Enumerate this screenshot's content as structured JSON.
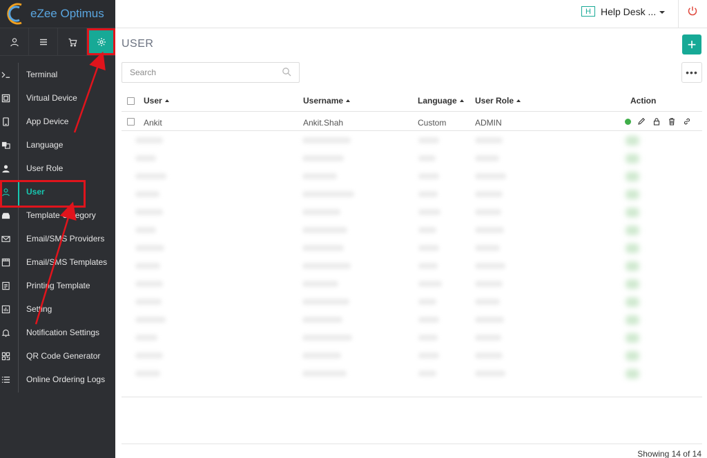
{
  "app": {
    "brand": "eZee Optimus"
  },
  "sidebar": {
    "tabs": [
      {
        "name": "user-tab",
        "icon": "person-icon"
      },
      {
        "name": "menu-tab",
        "icon": "list-icon"
      },
      {
        "name": "cart-tab",
        "icon": "cart-icon"
      },
      {
        "name": "settings-tab",
        "icon": "gear-icon",
        "active": true
      }
    ],
    "items": [
      {
        "label": "Terminal",
        "icon": "terminal-icon"
      },
      {
        "label": "Virtual Device",
        "icon": "monitor-icon"
      },
      {
        "label": "App Device",
        "icon": "phone-icon"
      },
      {
        "label": "Language",
        "icon": "translate-icon"
      },
      {
        "label": "User Role",
        "icon": "user-role-icon"
      },
      {
        "label": "User",
        "icon": "user-icon",
        "active": true
      },
      {
        "label": "Template Category",
        "icon": "inbox-icon"
      },
      {
        "label": "Email/SMS Providers",
        "icon": "mail-icon"
      },
      {
        "label": "Email/SMS Templates",
        "icon": "template-icon"
      },
      {
        "label": "Printing Template",
        "icon": "print-doc-icon"
      },
      {
        "label": "Setting",
        "icon": "settings-chart-icon"
      },
      {
        "label": "Notification Settings",
        "icon": "bell-icon"
      },
      {
        "label": "QR Code Generator",
        "icon": "qr-icon"
      },
      {
        "label": "Online Ordering Logs",
        "icon": "list-log-icon"
      }
    ]
  },
  "topbar": {
    "badge": "H",
    "location": "Help Desk ...",
    "power_icon": "power-icon"
  },
  "main": {
    "title": "USER",
    "add_label": "+",
    "search": {
      "placeholder": "Search",
      "value": ""
    },
    "more_label": "•••",
    "table": {
      "columns": [
        "User",
        "Username",
        "Language",
        "User Role",
        "Action"
      ],
      "rows": [
        {
          "user": "Ankit",
          "username": "Ankit.Shah",
          "language": "Custom",
          "role": "ADMIN",
          "status": "active"
        }
      ]
    },
    "footer": "Showing 14 of 14"
  },
  "colors": {
    "accent": "#17a996",
    "sidebar_bg": "#2d2f33",
    "annotation": "#e0141c",
    "status_active": "#3fae49"
  }
}
